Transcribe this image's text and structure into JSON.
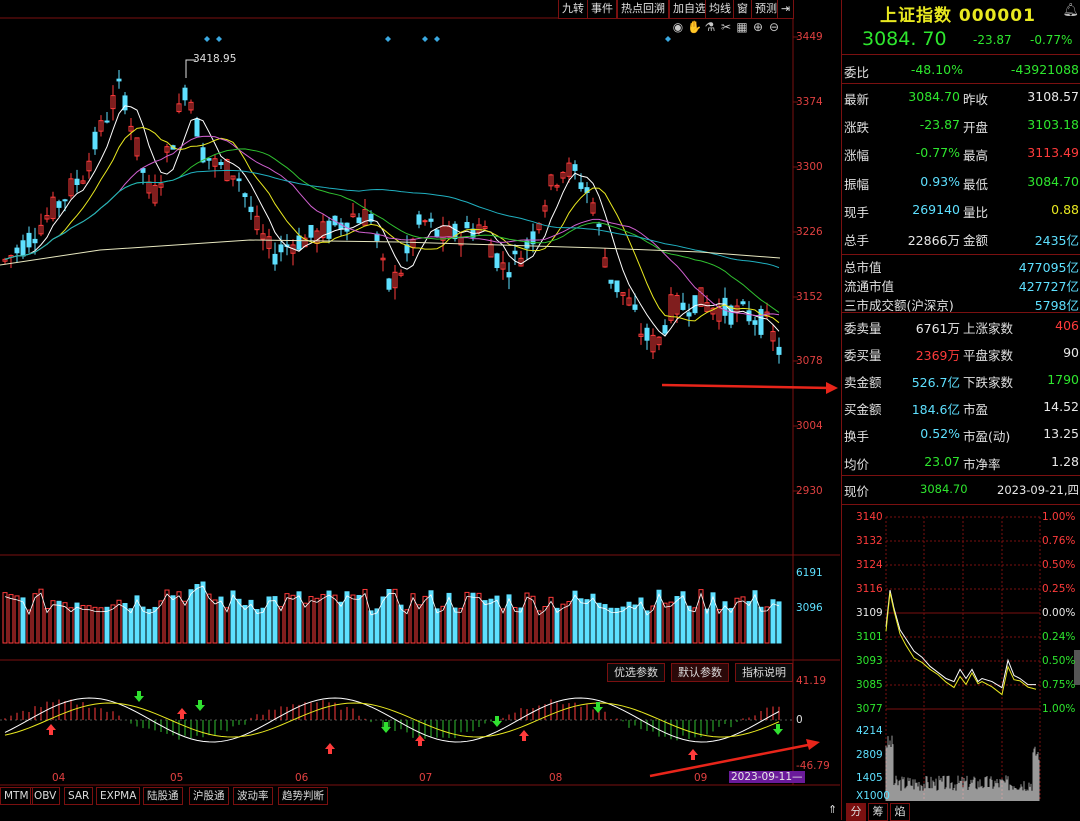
{
  "toolbar": {
    "buttons": [
      "九转",
      "事件",
      "热点回溯",
      "加自选",
      "均线",
      "窗",
      "预测"
    ]
  },
  "price_axis": [
    "3449",
    "3374",
    "3300",
    "3226",
    "3152",
    "3078",
    "3004",
    "2930"
  ],
  "high_annotation": "3418.95",
  "volume_axis": [
    "6191",
    "3096"
  ],
  "macd_axis": {
    "top": "41.19",
    "mid": "0",
    "bottom": "-46.79"
  },
  "macd_params": [
    "优选参数",
    "默认参数",
    "指标说明"
  ],
  "months": [
    "04",
    "05",
    "06",
    "07",
    "08",
    "09"
  ],
  "cursor_date": "2023-09-11—",
  "bottom_tabs": [
    "MTM",
    "OBV",
    "SAR",
    "EXPMA",
    "陆股通",
    "沪股通",
    "波动率",
    "趋势判断"
  ],
  "panel": {
    "title": "上证指数",
    "code": "000001",
    "price": "3084. 70",
    "change": "-23.87",
    "change_pct": "-0.77%",
    "weibi": {
      "label": "委比",
      "pct": "-48.10%",
      "val": "-43921088"
    },
    "rows1": [
      {
        "l1": "最新",
        "v1": "3084.70",
        "c1": "g",
        "l2": "昨收",
        "v2": "3108.57",
        "c2": "w"
      },
      {
        "l1": "涨跌",
        "v1": "-23.87",
        "c1": "g",
        "l2": "开盘",
        "v2": "3103.18",
        "c2": "g"
      },
      {
        "l1": "涨幅",
        "v1": "-0.77%",
        "c1": "g",
        "l2": "最高",
        "v2": "3113.49",
        "c2": "r"
      },
      {
        "l1": "振幅",
        "v1": "0.93%",
        "c1": "c",
        "l2": "最低",
        "v2": "3084.70",
        "c2": "g"
      },
      {
        "l1": "现手",
        "v1": "269140",
        "c1": "c",
        "l2": "量比",
        "v2": "0.88",
        "c2": "y"
      },
      {
        "l1": "总手",
        "v1": "22866万",
        "c1": "w",
        "l2": "金额",
        "v2": "2435亿",
        "c2": "c"
      }
    ],
    "mktcap": [
      {
        "l": "总市值",
        "v": "477095亿"
      },
      {
        "l": "流通市值",
        "v": "427727亿"
      },
      {
        "l": "三市成交额(沪深京)",
        "v": "5798亿"
      }
    ],
    "rows2": [
      {
        "l1": "委卖量",
        "v1": "6761万",
        "c1": "w",
        "l2": "上涨家数",
        "v2": "406",
        "c2": "r"
      },
      {
        "l1": "委买量",
        "v1": "2369万",
        "c1": "r",
        "l2": "平盘家数",
        "v2": "90",
        "c2": "w"
      },
      {
        "l1": "卖金额",
        "v1": "526.7亿",
        "c1": "c",
        "l2": "下跌家数",
        "v2": "1790",
        "c2": "g"
      },
      {
        "l1": "买金额",
        "v1": "184.6亿",
        "c1": "c",
        "l2": "市盈",
        "v2": "14.52",
        "c2": "w"
      },
      {
        "l1": "换手",
        "v1": "0.52%",
        "c1": "c",
        "l2": "市盈(动)",
        "v2": "13.25",
        "c2": "w"
      },
      {
        "l1": "均价",
        "v1": "23.07",
        "c1": "g",
        "l2": "市净率",
        "v2": "1.28",
        "c2": "w"
      }
    ],
    "now": {
      "label": "现价",
      "price": "3084.70",
      "date": "2023-09-21,四"
    },
    "mini_price_axis": [
      "3140",
      "3132",
      "3124",
      "3116",
      "3109",
      "3101",
      "3093",
      "3085",
      "3077"
    ],
    "mini_pct_axis": [
      "1.00%",
      "0.76%",
      "0.50%",
      "0.25%",
      "0.00%",
      "0.24%",
      "0.50%",
      "0.75%",
      "1.00%"
    ],
    "mini_vol_axis": [
      "4214",
      "2809",
      "1405",
      "X1000"
    ],
    "bottom_tabs": [
      "分",
      "筹",
      "焰"
    ]
  },
  "colors": {
    "up": "#ff3b3b",
    "down": "#5ee0ff",
    "grid": "#7a1010",
    "arrow": "#e8251a"
  }
}
